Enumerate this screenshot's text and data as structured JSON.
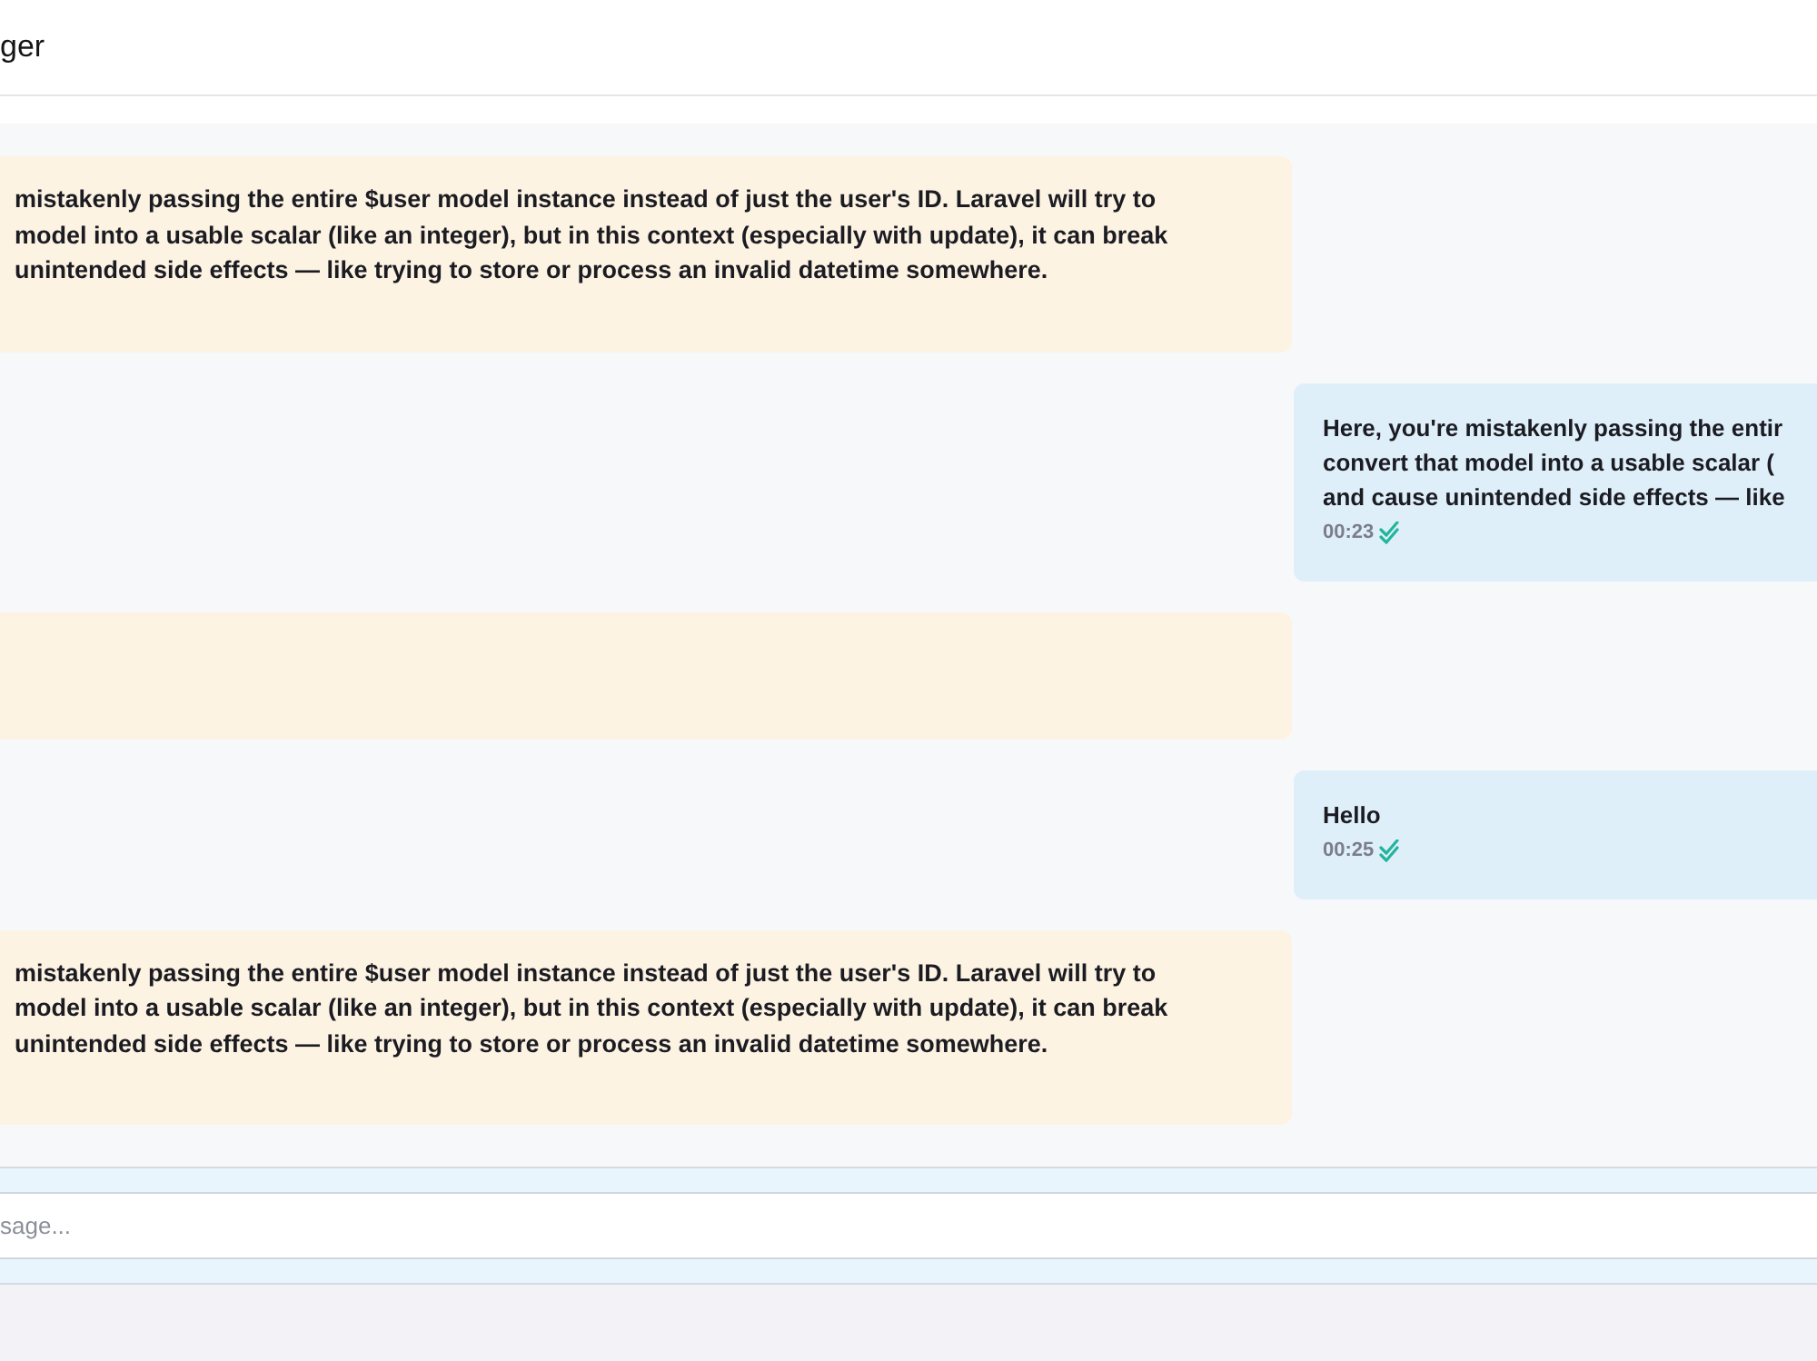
{
  "header": {
    "title": "ger"
  },
  "messages": [
    {
      "kind": "received",
      "lines": [
        "mistakenly passing the entire $user model instance instead of just the user's ID. Laravel will try to",
        "model into a usable scalar (like an integer), but in this context (especially with update), it can break",
        "unintended side effects — like trying to store or process an invalid datetime somewhere."
      ]
    },
    {
      "kind": "sent",
      "lines": [
        "Here, you're mistakenly passing the entir",
        "convert that model into a usable scalar (",
        "and cause unintended side effects — like"
      ],
      "time": "00:23",
      "read": true
    },
    {
      "kind": "received"
    },
    {
      "kind": "sent",
      "lines": [
        "Hello"
      ],
      "time": "00:25",
      "read": true
    },
    {
      "kind": "received",
      "lines": [
        "mistakenly passing the entire $user model instance instead of just the user's ID. Laravel will try to",
        "model into a usable scalar (like an integer), but in this context (especially with update), it can break",
        "unintended side effects — like trying to store or process an invalid datetime somewhere."
      ]
    }
  ],
  "composer": {
    "placeholder": "sage..."
  }
}
